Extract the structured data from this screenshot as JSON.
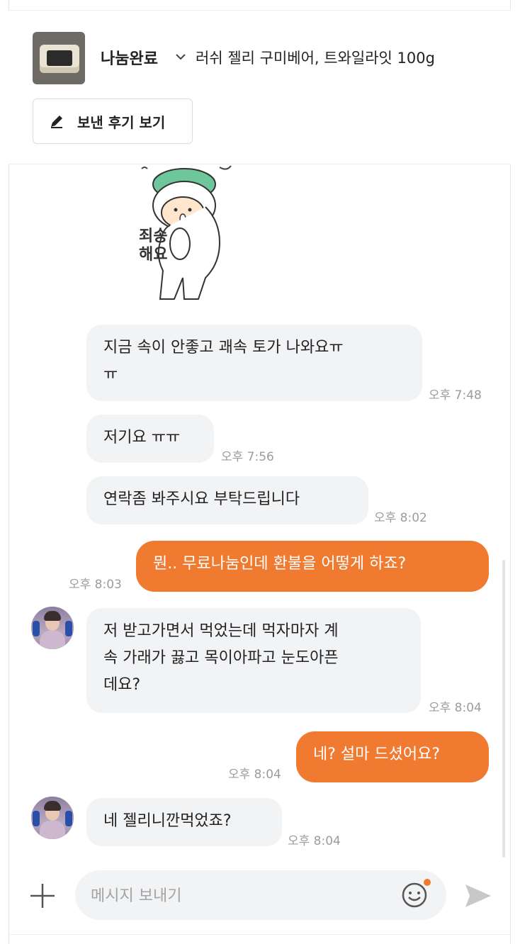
{
  "header": {
    "status": "나눔완료",
    "product_title": "러쉬 젤리 구미베어, 트와일라잇 100g",
    "review_button": "보낸 후기 보기"
  },
  "sticker": {
    "text_line1": "죄송",
    "text_line2": "해요"
  },
  "messages": [
    {
      "from": "other",
      "text_line1": "지금 속이 안좋고 괘속 토가 나와요ㅠ",
      "text_line2": "ㅠ",
      "time": "오후 7:48"
    },
    {
      "from": "other",
      "text": "저기요 ㅠㅠ",
      "time": "오후 7:56"
    },
    {
      "from": "other",
      "text": "연락좀 봐주시요 부탁드립니다",
      "time": "오후 8:02"
    },
    {
      "from": "me",
      "text": "뭔.. 무료나눔인데 환불을 어떻게 하죠?",
      "time": "오후 8:03"
    },
    {
      "from": "other",
      "text_line1": "저 받고가면서 먹었는데 먹자마자 계",
      "text_line2": "속 가래가 끓고 목이아파고 눈도아픈",
      "text_line3": "데요?",
      "time": "오후 8:04"
    },
    {
      "from": "me",
      "text": "네? 설마 드셨어요?",
      "time": "오후 8:04"
    },
    {
      "from": "other",
      "text": "네 젤리니깐먹었죠?",
      "time": "오후 8:04"
    }
  ],
  "composer": {
    "placeholder": "메시지 보내기"
  },
  "colors": {
    "accent": "#ef7a30",
    "incoming_bubble": "#f2f3f5",
    "time_text": "#9c9c9c"
  },
  "icons": [
    "chevron-down-icon",
    "pencil-icon",
    "plus-icon",
    "emoji-icon",
    "send-icon"
  ]
}
